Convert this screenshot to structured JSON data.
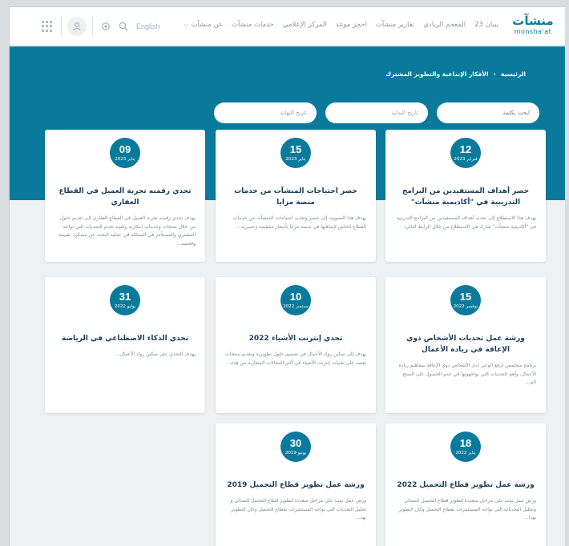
{
  "header": {
    "logo_ar": "منشآت",
    "logo_en": "monsha'at",
    "nav": [
      "عن منشآت",
      "خدمات منشآت",
      "المركز الإعلامي",
      "احجز موعد",
      "تقارير منشآت",
      "المعجم الريادي",
      "بيبان 23"
    ],
    "lang": "English"
  },
  "breadcrumb": {
    "home": "الرئيسية",
    "current": "الأفكار الإبداعية والتطوير المشترك"
  },
  "filters": {
    "search_placeholder": "ابحث بكلمة",
    "start_placeholder": "تاريخ البداية",
    "end_placeholder": "تاريخ النهاية"
  },
  "cards": [
    {
      "day": "12",
      "month": "فبراير 2023",
      "title": "حصر أهداف المستفيدين من البرامج التدريبية في \"أكاديمية منشآت\"",
      "text": "يهدف هذا الاستطلاع إلى تحديد أهداف المستفيدين من البرامج التدريبية في \"أكاديمية منشآت\" شارك في الاستطلاع من خلال الرابط التالي:"
    },
    {
      "day": "15",
      "month": "يناير 2023",
      "title": "حصر احتياجات المنشآت من خدمات منصة مزايا",
      "text": "يهدف هذا التصويت إلى حصر وتحديد احتياجات المنشآت من خدمات القطاع الخاص لإضافتها في منصة مزايا بأسعار مخفضة وحصرية..."
    },
    {
      "day": "09",
      "month": "يناير 2023",
      "title": "تحدي رقمنه تجربة العميل في القطاع العقاري",
      "text": "يهدف تحدي رقمنه تجربة العميل في القطاع العقاري إلى تقديم حلول من خلال منتجات وخدمات ابتكارية وتقنية تخدم التحديات التي تواجه المشتري والمستأجر في المملكة في عملية البحث عن مسكن، تقييمه وفحصه..."
    },
    {
      "day": "15",
      "month": "نوفمبر 2022",
      "title": "ورشة عمل تحديات الأشخاص ذوي الإعاقة في ريادة الأعمال",
      "text": "برنامج متخصص لرفع الوعي لدى الأشخاص ذوي الإعاقة بمفاهيم ريادة الأعمال، وأهم التحديات التي يواجهونها في عدم الحصول على المنتج الم..."
    },
    {
      "day": "10",
      "month": "سبتمبر 2022",
      "title": "تحدي إنترنت الأشياء 2022",
      "text": "يهدف إلى تمكين رواد الأعمال في تصميم حلول تطويرية وتقديم منتجات تعتمد على تقنيات إنترنت الأشياء في أكثر المجالات المتقاربة من هذه..."
    },
    {
      "day": "31",
      "month": "يوليو 2022",
      "title": "تحدي الذكاء الاصطناعي في الرياضة",
      "text": "يهدف التحدي على تمكين رواد الأعمال..."
    },
    {
      "day": "18",
      "month": "يناير 2022",
      "title": "ورشة عمل تطوير قطاع التجميل 2022",
      "text": "ورش عمل تمت على مراحل متعددة لتطوير قطاع التجميل النسائي وتحليل التحديات التي تواجه المستثمرات بقطاع التجميل وكان التطوير بهذا..."
    },
    {
      "day": "30",
      "month": "يونيو 2019",
      "title": "ورشة عمل تطوير قطاع التجميل 2019",
      "text": "ورش عمل تمت على مراحل متعددة لتطوير قطاع التجميل النسائي و تحليل التحديات التي تواجه المستثمرات بقطاع التجميل وكان التطوير بهذ..."
    }
  ]
}
